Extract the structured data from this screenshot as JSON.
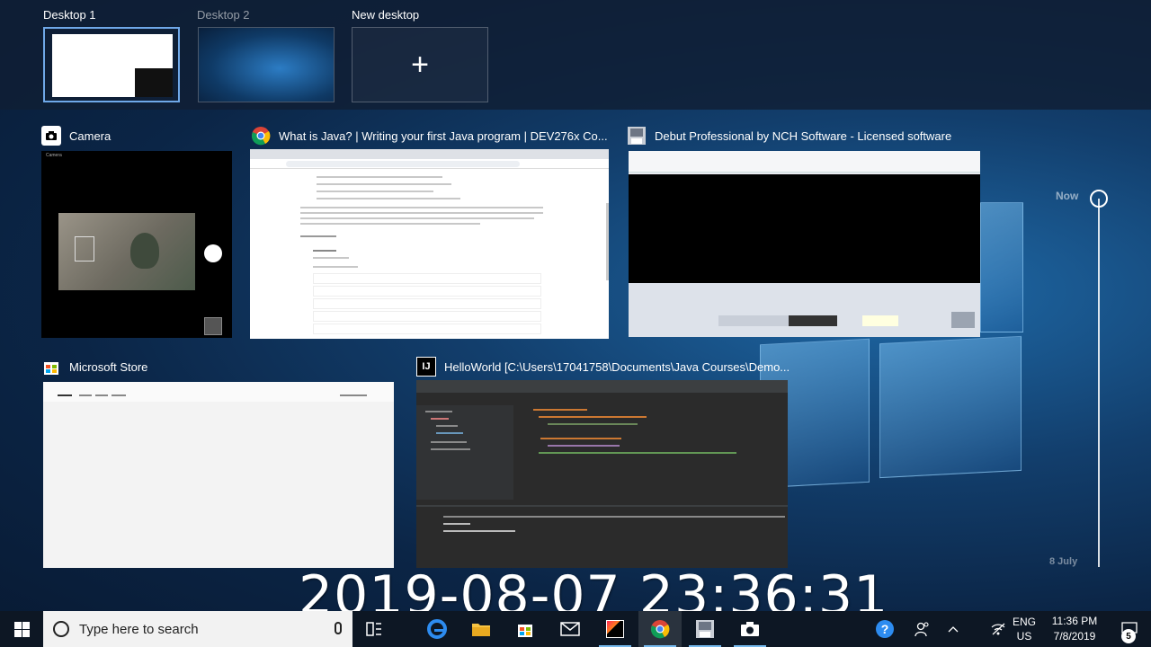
{
  "desktops": [
    {
      "label": "Desktop 1",
      "active": true
    },
    {
      "label": "Desktop 2",
      "active": false
    },
    {
      "label": "New desktop",
      "icon": "plus-icon"
    }
  ],
  "windows": [
    {
      "title": "Camera",
      "icon": "camera-app-icon"
    },
    {
      "title": "What is Java? | Writing your first Java program | DEV276x Co...",
      "icon": "chrome-icon"
    },
    {
      "title": "Debut Professional by NCH Software - Licensed software",
      "icon": "debut-icon"
    },
    {
      "title": "Microsoft Store",
      "icon": "store-icon"
    },
    {
      "title": "HelloWorld [C:\\Users\\17041758\\Documents\\Java Courses\\Demo...",
      "icon": "intellij-icon"
    }
  ],
  "timeline": {
    "now_label": "Now",
    "date_label": "8 July"
  },
  "overlay_timestamp": "2019-08-07 23:36:31",
  "taskbar": {
    "search_placeholder": "Type here to search",
    "lang_line1": "ENG",
    "lang_line2": "US",
    "time": "11:36 PM",
    "date": "7/8/2019",
    "notification_count": "5"
  },
  "colors": {
    "accent": "#76b9ed",
    "taskbar": "#0d1724",
    "desktop_strip": "#101e34"
  }
}
